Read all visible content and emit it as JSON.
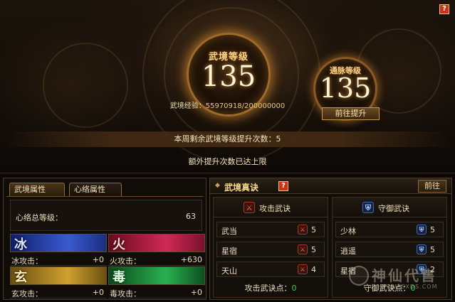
{
  "top": {
    "help_label": "?",
    "main_orb": {
      "label": "武境等级",
      "value": "135"
    },
    "small_orb": {
      "label": "通脉等级",
      "value": "135"
    },
    "exp": {
      "label": "武境经验：",
      "value": "55970918/200000000"
    },
    "go_upgrade_label": "前往提升",
    "weekly_text": "本周剩余武境等级提升次数：5",
    "extra_limit_text": "额外提升次数已达上限"
  },
  "left_panel": {
    "tabs": [
      {
        "label": "武境属性",
        "active": true
      },
      {
        "label": "心络属性",
        "active": false
      }
    ],
    "total": {
      "label": "心络总等级：",
      "value": "63"
    },
    "elements": [
      {
        "glyph": "冰",
        "label": "冰攻击：",
        "value": "+0",
        "color": "#3a5ad0"
      },
      {
        "glyph": "火",
        "label": "火攻击：",
        "value": "+630",
        "color": "#d02a55"
      },
      {
        "glyph": "玄",
        "label": "玄攻击：",
        "value": "+0",
        "color": "#d0a030"
      },
      {
        "glyph": "毒",
        "label": "毒攻击：",
        "value": "+0",
        "color": "#2ab050"
      }
    ]
  },
  "right_panel": {
    "title": "武境真诀",
    "help_label": "?",
    "go_label": "前往",
    "attack": {
      "title": "攻击武诀",
      "icon": "attack-rune-icon",
      "rows": [
        {
          "name": "武当",
          "value": "5"
        },
        {
          "name": "星宿",
          "value": "5"
        },
        {
          "name": "天山",
          "value": "4"
        }
      ],
      "points_label": "攻击武诀点：",
      "points_value": "0"
    },
    "defense": {
      "title": "守御武诀",
      "icon": "shield-rune-icon",
      "rows": [
        {
          "name": "少林",
          "value": "5"
        },
        {
          "name": "逍遥",
          "value": "5"
        },
        {
          "name": "星宿",
          "value": "2"
        }
      ],
      "points_label": "守御武诀点：",
      "points_value": "0"
    }
  },
  "watermark": {
    "text": "神仙代售",
    "url": "WWW.SXDS.COM"
  }
}
